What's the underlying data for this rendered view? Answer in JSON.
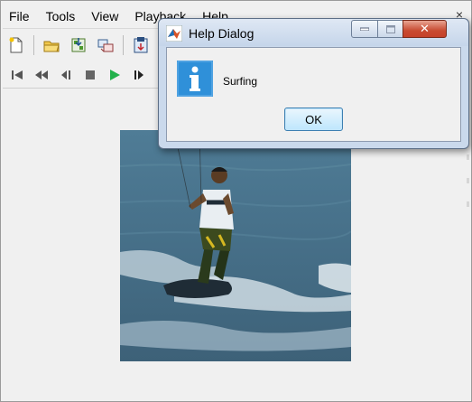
{
  "window": {
    "menu": [
      {
        "label": "File"
      },
      {
        "label": "Tools"
      },
      {
        "label": "View"
      },
      {
        "label": "Playback"
      },
      {
        "label": "Help"
      }
    ],
    "toolbar_icons": [
      "new-file-icon",
      "open-folder-icon",
      "import-icon",
      "connect-icon",
      "export-icon"
    ],
    "playback_icons": [
      "go-to-first-icon",
      "rewind-icon",
      "step-back-icon",
      "stop-icon",
      "play-icon",
      "step-forward-icon"
    ],
    "close_glyph": "×"
  },
  "video": {
    "description_icon": "video-frame-icon"
  },
  "dialog": {
    "title": "Help Dialog",
    "message": "Surfing",
    "ok_label": "OK",
    "close_glyph": "✕",
    "icon": "info-icon",
    "colors": {
      "info_blue": "#2f90d9",
      "close_red": "#c84b31",
      "play_green": "#22b14c"
    }
  }
}
